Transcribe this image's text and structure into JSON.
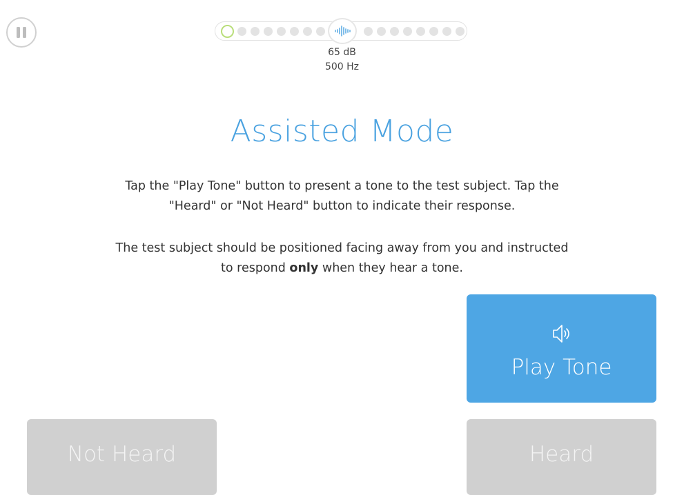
{
  "controls": {
    "pause_icon": "pause-icon"
  },
  "progress": {
    "current_index": 0,
    "dots_before": 7,
    "dots_after": 7,
    "current_icon": "sound-wave-icon",
    "current_color": "#b9de7a"
  },
  "level": {
    "intensity": "65 dB",
    "frequency": "500 Hz"
  },
  "main": {
    "title": "Assisted Mode",
    "instructions_line1": "Tap the \"Play Tone\" button to present a tone to the test subject. Tap the",
    "instructions_line2": "\"Heard\" or \"Not Heard\" button to indicate their response.",
    "note_line1": "The test subject should be positioned facing away from you and instructed",
    "note_prefix": "to respond ",
    "note_bold": "only",
    "note_suffix": " when they hear a tone."
  },
  "buttons": {
    "play_label": "Play Tone",
    "play_icon": "speaker-icon",
    "not_heard_label": "Not Heard",
    "heard_label": "Heard"
  },
  "colors": {
    "accent": "#4aa2e0",
    "play_button": "#4ea6e4",
    "disabled_button": "#d0d0d0"
  }
}
